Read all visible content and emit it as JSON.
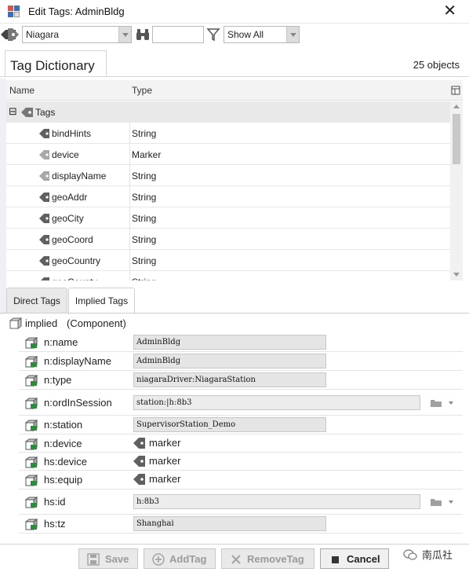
{
  "window": {
    "title": "Edit Tags: AdminBldg",
    "close_glyph": "✕"
  },
  "toolbar": {
    "dictionary_value": "Niagara",
    "filter_input_value": "",
    "show_value": "Show All"
  },
  "dictionary": {
    "tab_label": "Tag Dictionary",
    "count": "25 objects",
    "columns": {
      "name": "Name",
      "type": "Type"
    },
    "group": {
      "toggle": "⊟",
      "label": "Tags"
    },
    "rows": [
      {
        "name": "bindHints",
        "type": "String"
      },
      {
        "name": "device",
        "type": "Marker"
      },
      {
        "name": "displayName",
        "type": "String"
      },
      {
        "name": "geoAddr",
        "type": "String"
      },
      {
        "name": "geoCity",
        "type": "String"
      },
      {
        "name": "geoCoord",
        "type": "String"
      },
      {
        "name": "geoCountry",
        "type": "String"
      },
      {
        "name": "geoCounty",
        "type": "String"
      }
    ]
  },
  "tabs": {
    "direct": "Direct Tags",
    "implied": "Implied Tags"
  },
  "implied": {
    "root_name": "implied",
    "root_type": "(Component)",
    "props": [
      {
        "name": "n:name",
        "value": "AdminBldg",
        "kind": "text"
      },
      {
        "name": "n:displayName",
        "value": "AdminBldg",
        "kind": "text"
      },
      {
        "name": "n:type",
        "value": "niagaraDriver:NiagaraStation",
        "kind": "text"
      },
      {
        "name": "n:ordInSession",
        "value": "station:|h:8b3",
        "kind": "ord"
      },
      {
        "name": "n:station",
        "value": "SupervisorStation_Demo",
        "kind": "text"
      },
      {
        "name": "n:device",
        "value": "marker",
        "kind": "marker"
      },
      {
        "name": "hs:device",
        "value": "marker",
        "kind": "marker"
      },
      {
        "name": "hs:equip",
        "value": "marker",
        "kind": "marker"
      },
      {
        "name": "hs:id",
        "value": "h:8b3",
        "kind": "ord"
      },
      {
        "name": "hs:tz",
        "value": "Shanghai",
        "kind": "text"
      }
    ]
  },
  "buttons": {
    "save": "Save",
    "add_tag": "AddTag",
    "remove_tag": "RemoveTag",
    "cancel": "Cancel"
  },
  "watermark": "南瓜社",
  "colors": {
    "tag_icon": "#606060",
    "tag_icon_light": "#a8a8a8",
    "cube_green": "#2e8b3d",
    "accent_blue": "#3a6fb7"
  }
}
